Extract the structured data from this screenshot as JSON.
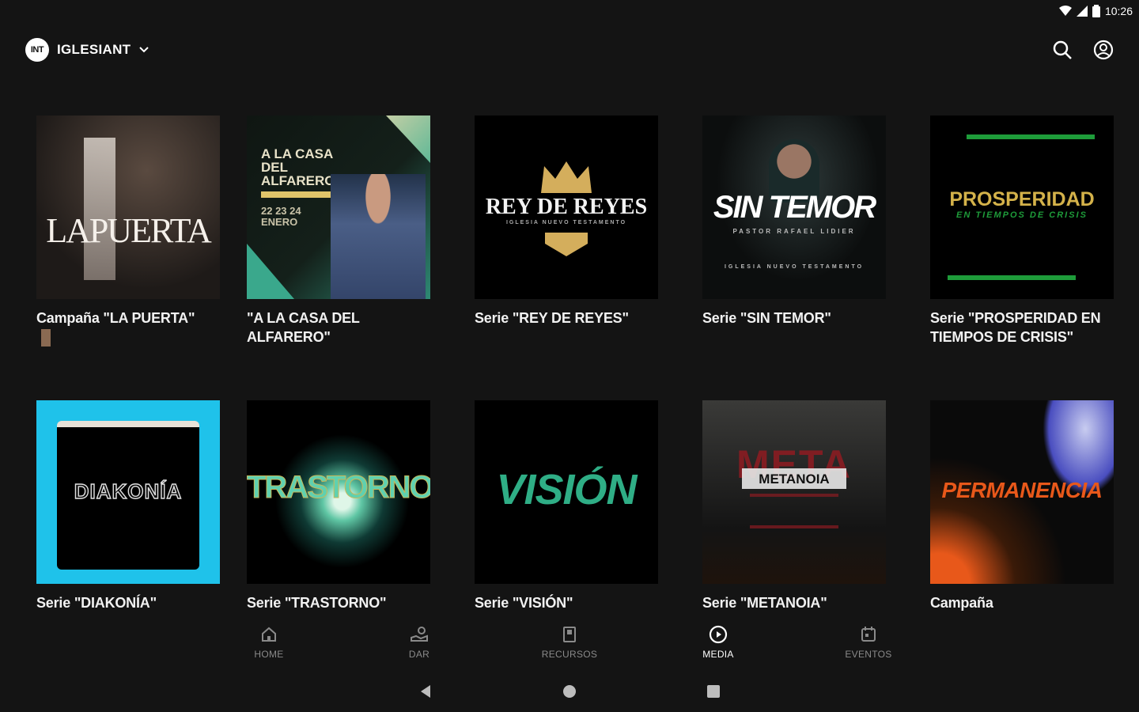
{
  "status_bar": {
    "time": "10:26"
  },
  "header": {
    "brand_logo_text": "INT",
    "brand_name": "IGLESIANT"
  },
  "cards": [
    {
      "title": "Campaña \"LA PUERTA\"",
      "art_text": "LAPUERTA"
    },
    {
      "title": "\"A LA CASA DEL ALFARERO\"",
      "art_text": "A LA CASA DEL ALFARERO",
      "art_sub": "22 23 24 ENERO"
    },
    {
      "title": "Serie \"REY DE REYES\"",
      "art_text": "REY DE REYES",
      "art_sub": "IGLESIA NUEVO TESTAMENTO"
    },
    {
      "title": "Serie \"SIN TEMOR\"",
      "art_text": "SIN TEMOR",
      "art_sub": "PASTOR RAFAEL LIDIER",
      "art_sub2": "IGLESIA NUEVO TESTAMENTO"
    },
    {
      "title": "Serie \"PROSPERIDAD EN TIEMPOS DE CRISIS\"",
      "art_text": "PROSPERIDAD",
      "art_sub": "EN TIEMPOS DE CRISIS"
    },
    {
      "title": "Serie \"DIAKONÍA\"",
      "art_text": "DIAKONÍA"
    },
    {
      "title": "Serie \"TRASTORNO\"",
      "art_text": "TRASTORNO"
    },
    {
      "title": "Serie \"VISIÓN\"",
      "art_text": "VISIÓN"
    },
    {
      "title": "Serie \"METANOIA\"",
      "art_text": "METANOIA",
      "art_sub": "META"
    },
    {
      "title": "Campaña \"PERMANENCIA\"",
      "art_text": "PERMANENCIA"
    }
  ],
  "bottom_nav": [
    {
      "label": "HOME",
      "icon": "home-icon",
      "active": false
    },
    {
      "label": "DAR",
      "icon": "give-icon",
      "active": false
    },
    {
      "label": "RECURSOS",
      "icon": "book-icon",
      "active": false
    },
    {
      "label": "MEDIA",
      "icon": "play-circle-icon",
      "active": true
    },
    {
      "label": "EVENTOS",
      "icon": "calendar-icon",
      "active": false
    }
  ],
  "colors": {
    "background": "#141414",
    "diakonia_frame": "#1fc2ea",
    "reyes_gold": "#d4ae5c",
    "prosperidad_green": "#1e9c3a",
    "vision_green": "#2fae86",
    "permanencia_orange": "#e8581a"
  }
}
